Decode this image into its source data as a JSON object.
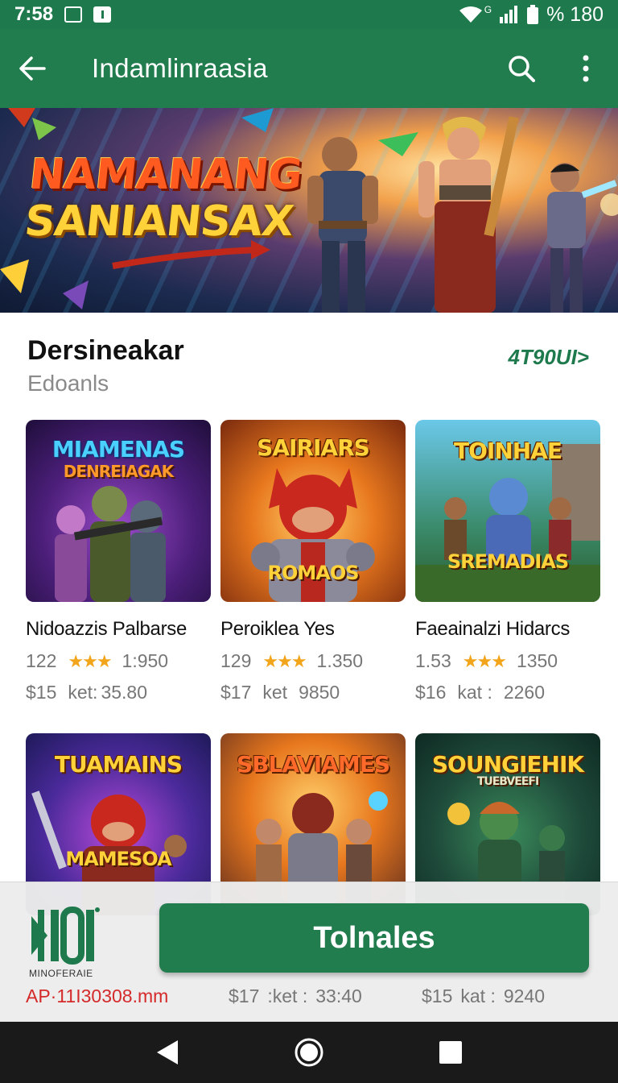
{
  "status_bar": {
    "time": "7:58",
    "signal_label": "G",
    "battery_label": "% 180"
  },
  "app_bar": {
    "title": "Indamlinraasia",
    "icons": [
      "back-arrow-icon",
      "search-icon",
      "more-vert-icon"
    ]
  },
  "hero": {
    "line1": "NAMANANG",
    "line2": "SANIANSAX"
  },
  "section": {
    "title": "Dersineakar",
    "subtitle": "Edoanls",
    "more_link": "4T90UI>"
  },
  "games": [
    {
      "thumb_title": "MIAMENAS",
      "thumb_sub": "DENREIAGAK",
      "name": "Nidoazzis Palbarse",
      "rating": "122",
      "stars": "★★★",
      "count": "1:950",
      "price": "$15",
      "ket_label": "ket:",
      "ket_value": "35.80"
    },
    {
      "thumb_title": "SAIRIARS",
      "thumb_sub": "ROMAOS",
      "name": "Peroiklea Yes",
      "rating": "129",
      "stars": "★★★",
      "count": "1.350",
      "price": "$17",
      "ket_label": "ket",
      "ket_value": "9850"
    },
    {
      "thumb_title": "TOINHAE",
      "thumb_sub": "SREMADIAS",
      "name": "Faeainalzi Hidarcs",
      "rating": "1.53",
      "stars": "★★★",
      "count": "1350",
      "price": "$16",
      "ket_label": "kat :",
      "ket_value": "2260"
    },
    {
      "thumb_title": "TUAMAINS",
      "thumb_sub": "MAMESOA",
      "name": "",
      "rating": "",
      "stars": "",
      "count": "",
      "price": "",
      "ket_label": "",
      "ket_value": ""
    },
    {
      "thumb_title": "SBLAVIAMES",
      "thumb_sub": "",
      "name": "",
      "rating": "",
      "stars": "",
      "count": "",
      "price": "$17",
      "ket_label": ":ket :",
      "ket_value": "33:40"
    },
    {
      "thumb_title": "SOUNGIEHIK",
      "thumb_sub": "TUEBVEEFI",
      "name": "",
      "rating": "",
      "stars": "",
      "count": "",
      "price": "$15",
      "ket_label": "kat :",
      "ket_value": "9240"
    }
  ],
  "ad_overlay": {
    "logo_text": "MINOFERAIE",
    "url": "AP·11I30308.mm",
    "install_label": "Tolnales"
  },
  "colors": {
    "primary": "#217c4e",
    "status": "#1e7a4c",
    "star": "#f2a51a",
    "ad_url": "#d42a2a"
  }
}
